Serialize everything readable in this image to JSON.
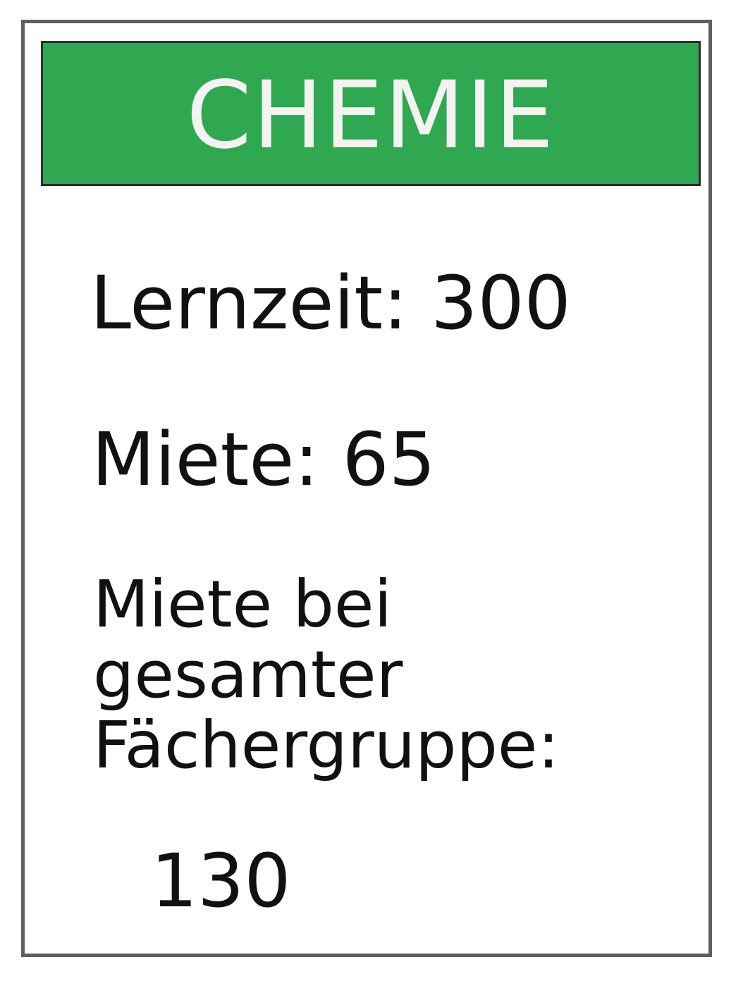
{
  "card": {
    "title": "CHEMIE",
    "lernzeit": "Lernzeit: 300",
    "miete": "Miete: 65",
    "miete_bei_line1": "Miete bei",
    "miete_bei_line2": "gesamter",
    "miete_bei_line3": "Fächergruppe:",
    "miete_bei_value": "130"
  },
  "colors": {
    "header_green": "#30a852",
    "title_text": "#f3f3f1",
    "body_text": "#111111",
    "card_border": "#5f5f5f"
  }
}
